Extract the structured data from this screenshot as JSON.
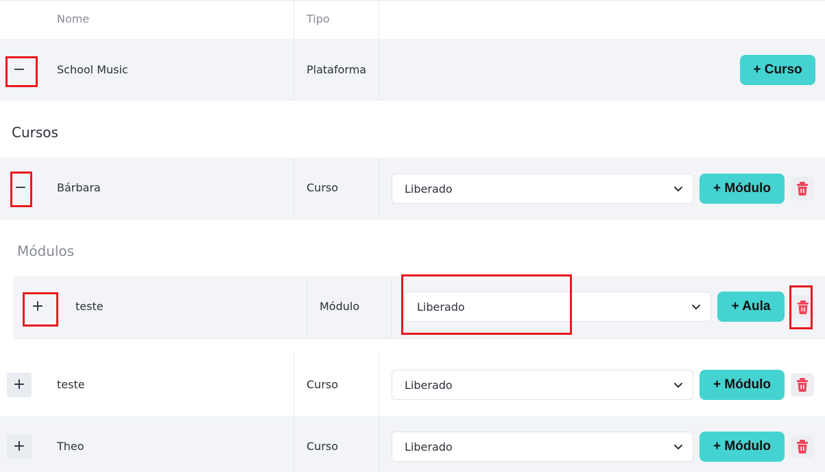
{
  "header": {
    "name_col": "Nome",
    "type_col": "Tipo"
  },
  "platform_row": {
    "toggle": "−",
    "name": "School Music",
    "type": "Plataforma",
    "add_button": "+ Curso"
  },
  "cursos_section": {
    "title": "Cursos"
  },
  "curso_barbara": {
    "toggle": "−",
    "name": "Bárbara",
    "type": "Curso",
    "status": "Liberado",
    "add_button": "+ Módulo"
  },
  "modulos_section": {
    "title": "Módulos"
  },
  "modulo_teste": {
    "toggle": "+",
    "name": "teste",
    "type": "Módulo",
    "status": "Liberado",
    "add_button": "+ Aula"
  },
  "curso_teste": {
    "toggle": "+",
    "name": "teste",
    "type": "Curso",
    "status": "Liberado",
    "add_button": "+ Módulo"
  },
  "curso_theo": {
    "toggle": "+",
    "name": "Theo",
    "type": "Curso",
    "status": "Liberado",
    "add_button": "+ Módulo"
  },
  "colors": {
    "accent": "#45d3d1",
    "row_bg": "#f2f4f7",
    "danger": "#f0455a",
    "highlight": "#e8191c"
  },
  "icons": {
    "toggle_minus": "minus-icon",
    "toggle_plus": "plus-icon",
    "dropdown": "chevron-down-icon",
    "delete": "trash-icon"
  }
}
